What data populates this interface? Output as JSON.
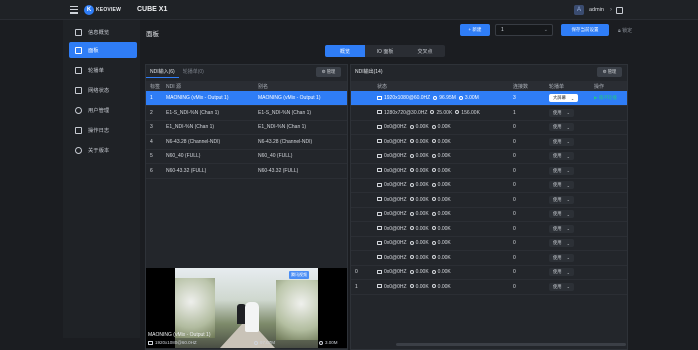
{
  "header": {
    "brand": "KEOVIEW",
    "product": "CUBE X1",
    "user": "admin",
    "avatar_letter": "A"
  },
  "sidebar": {
    "items": [
      {
        "label": "信息概览",
        "icon": "info-icon"
      },
      {
        "label": "面板",
        "icon": "panel-icon",
        "active": true
      },
      {
        "label": "轮播单",
        "icon": "carousel-icon"
      },
      {
        "label": "网络状态",
        "icon": "network-icon"
      },
      {
        "label": "用户管理",
        "icon": "user-icon"
      },
      {
        "label": "操作日志",
        "icon": "log-icon"
      },
      {
        "label": "关于版本",
        "icon": "about-icon"
      }
    ]
  },
  "main": {
    "title": "面板",
    "add_label": "+ 新建",
    "preset_value": "1",
    "save_label": "保存当前设置",
    "lock_label": "锁定",
    "tabs": [
      {
        "label": "概览",
        "active": true
      },
      {
        "label": "IO 面板"
      },
      {
        "label": "交叉点"
      }
    ]
  },
  "left_panel": {
    "tabs": [
      {
        "label": "NDI输入(6)",
        "active": true
      },
      {
        "label": "轮播单(0)"
      }
    ],
    "manage_label": "管理",
    "columns": [
      "标签",
      "NDI 源",
      "别名"
    ],
    "rows": [
      {
        "tag": "1",
        "source": "MAONING (vMix - Output 1)",
        "alias": "MAONING (vMix - Output 1)",
        "selected": true
      },
      {
        "tag": "2",
        "source": "E1-S_NDI-%N (Chan 1)",
        "alias": "E1-S_NDI-%N (Chan 1)"
      },
      {
        "tag": "3",
        "source": "E1_NDI-%N (Chan 1)",
        "alias": "E1_NDI-%N (Chan 1)"
      },
      {
        "tag": "4",
        "source": "N6-43.28 (Channel-NDI)",
        "alias": "N6-43.28 (Channel-NDI)"
      },
      {
        "tag": "5",
        "source": "N60_40 (FULL)",
        "alias": "N60_40 (FULL)"
      },
      {
        "tag": "6",
        "source": "N60-43.32 (FULL)",
        "alias": "N60-43.32 (FULL)"
      }
    ],
    "preview": {
      "name": "MAONING (vMix - Output 1)",
      "resolution": "1920x1080@60.0HZ",
      "fps": "97.07M",
      "bandwidth": "3.00M",
      "watermark": "腾讯视频"
    }
  },
  "right_panel": {
    "title": "NDI输出(14)",
    "manage_label": "管理",
    "columns": [
      "",
      "状态",
      "连接数",
      "轮播单",
      "操作"
    ],
    "rows": [
      {
        "label": "",
        "res": "1920x1080@60.0HZ",
        "rate1": "96.95M",
        "rate2": "3.00M",
        "conn": "3",
        "mode": "大屏幕",
        "op": "循环轮播",
        "selected": true
      },
      {
        "label": "",
        "res": "1280x720@30.0HZ",
        "rate1": "25.00K",
        "rate2": "156.00K",
        "conn": "1",
        "mode": "使用"
      },
      {
        "label": "",
        "res": "0x0@0HZ",
        "rate1": "0.00K",
        "rate2": "0.00K",
        "conn": "0",
        "mode": "使用"
      },
      {
        "label": "",
        "res": "0x0@0HZ",
        "rate1": "0.00K",
        "rate2": "0.00K",
        "conn": "0",
        "mode": "使用"
      },
      {
        "label": "",
        "res": "0x0@0HZ",
        "rate1": "0.00K",
        "rate2": "0.00K",
        "conn": "0",
        "mode": "使用"
      },
      {
        "label": "",
        "res": "0x0@0HZ",
        "rate1": "0.00K",
        "rate2": "0.00K",
        "conn": "0",
        "mode": "使用"
      },
      {
        "label": "",
        "res": "0x0@0HZ",
        "rate1": "0.00K",
        "rate2": "0.00K",
        "conn": "0",
        "mode": "使用"
      },
      {
        "label": "",
        "res": "0x0@0HZ",
        "rate1": "0.00K",
        "rate2": "0.00K",
        "conn": "0",
        "mode": "使用"
      },
      {
        "label": "",
        "res": "0x0@0HZ",
        "rate1": "0.00K",
        "rate2": "0.00K",
        "conn": "0",
        "mode": "使用"
      },
      {
        "label": "",
        "res": "0x0@0HZ",
        "rate1": "0.00K",
        "rate2": "0.00K",
        "conn": "0",
        "mode": "使用"
      },
      {
        "label": "",
        "res": "0x0@0HZ",
        "rate1": "0.00K",
        "rate2": "0.00K",
        "conn": "0",
        "mode": "使用"
      },
      {
        "label": "",
        "res": "0x0@0HZ",
        "rate1": "0.00K",
        "rate2": "0.00K",
        "conn": "0",
        "mode": "使用"
      },
      {
        "label": "0",
        "res": "0x0@0HZ",
        "rate1": "0.00K",
        "rate2": "0.00K",
        "conn": "0",
        "mode": "使用"
      },
      {
        "label": "1",
        "res": "0x0@0HZ",
        "rate1": "0.00K",
        "rate2": "0.00K",
        "conn": "0",
        "mode": "使用"
      }
    ]
  }
}
